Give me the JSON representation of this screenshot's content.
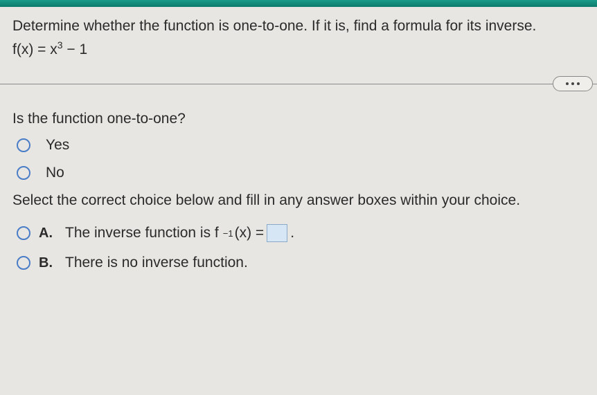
{
  "question": {
    "prompt": "Determine whether the function is one-to-one. If it is, find a formula for its inverse.",
    "formula_lhs": "f(x) = x",
    "formula_exp": "3",
    "formula_rhs": " − 1"
  },
  "sub_question": "Is the function one-to-one?",
  "yn_options": [
    {
      "label": "Yes"
    },
    {
      "label": "No"
    }
  ],
  "instruction": "Select the correct choice below and fill in any answer boxes within your choice.",
  "choices": {
    "a": {
      "letter": "A.",
      "prefix": "The inverse function is f",
      "sup": "−1",
      "mid": "(x) = ",
      "suffix": "."
    },
    "b": {
      "letter": "B.",
      "text": "There is no inverse function."
    }
  }
}
